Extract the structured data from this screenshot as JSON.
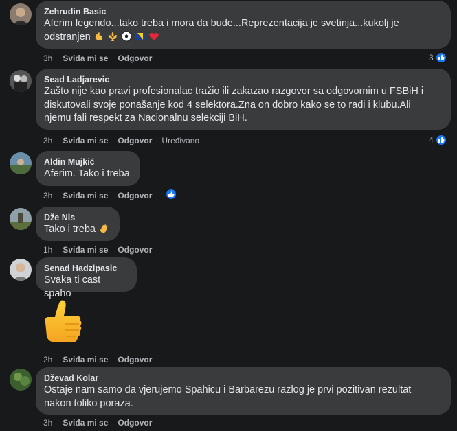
{
  "comments": [
    {
      "author": "Zehrudin Basic",
      "line1": "Aferim legendo...tako treba i mora da bude...Reprezentacija je svetinja...kukolj je",
      "line2": "odstranjen",
      "time": "3h",
      "like": "Sviđa mi se",
      "reply": "Odgovor",
      "reaction_count": "3"
    },
    {
      "author": "Sead Ladjarevic",
      "line1": "Zašto nije kao pravi profesionalac tražio ili zakazao razgovor sa odgovornim u FSBiH i",
      "line2": "diskutovali svoje ponašanje kod 4 selektora.Zna on dobro kako se to radi i klubu.Ali",
      "line3": "njemu fali respekt za Nacionalnu selekciji BiH.",
      "time": "3h",
      "like": "Sviđa mi se",
      "reply": "Odgovor",
      "edited": "Uređivano",
      "reaction_count": "4"
    },
    {
      "author": "Aldin Mujkić",
      "line1": "Aferim. Tako i treba",
      "time": "3h",
      "like": "Sviđa mi se",
      "reply": "Odgovor"
    },
    {
      "author": "Dže Nis",
      "line1": "Tako i treba",
      "time": "1h",
      "like": "Sviđa mi se",
      "reply": "Odgovor"
    },
    {
      "author": "Senad Hadzipasic",
      "line1": "Svaka ti cast spaho",
      "time": "2h",
      "like": "Sviđa mi se",
      "reply": "Odgovor"
    },
    {
      "author": "Dževad Kolar",
      "line1": "Ostaje nam samo da vjerujemo Spahicu i Barbarezu razlog je prvi pozitivan rezultat",
      "line2": "nakon toliko poraza.",
      "time": "3h",
      "like": "Sviđa mi se",
      "reply": "Odgovor"
    }
  ],
  "colors": {
    "background": "#18191a",
    "bubble": "#3a3b3c",
    "like_blue": "#1877f2"
  }
}
